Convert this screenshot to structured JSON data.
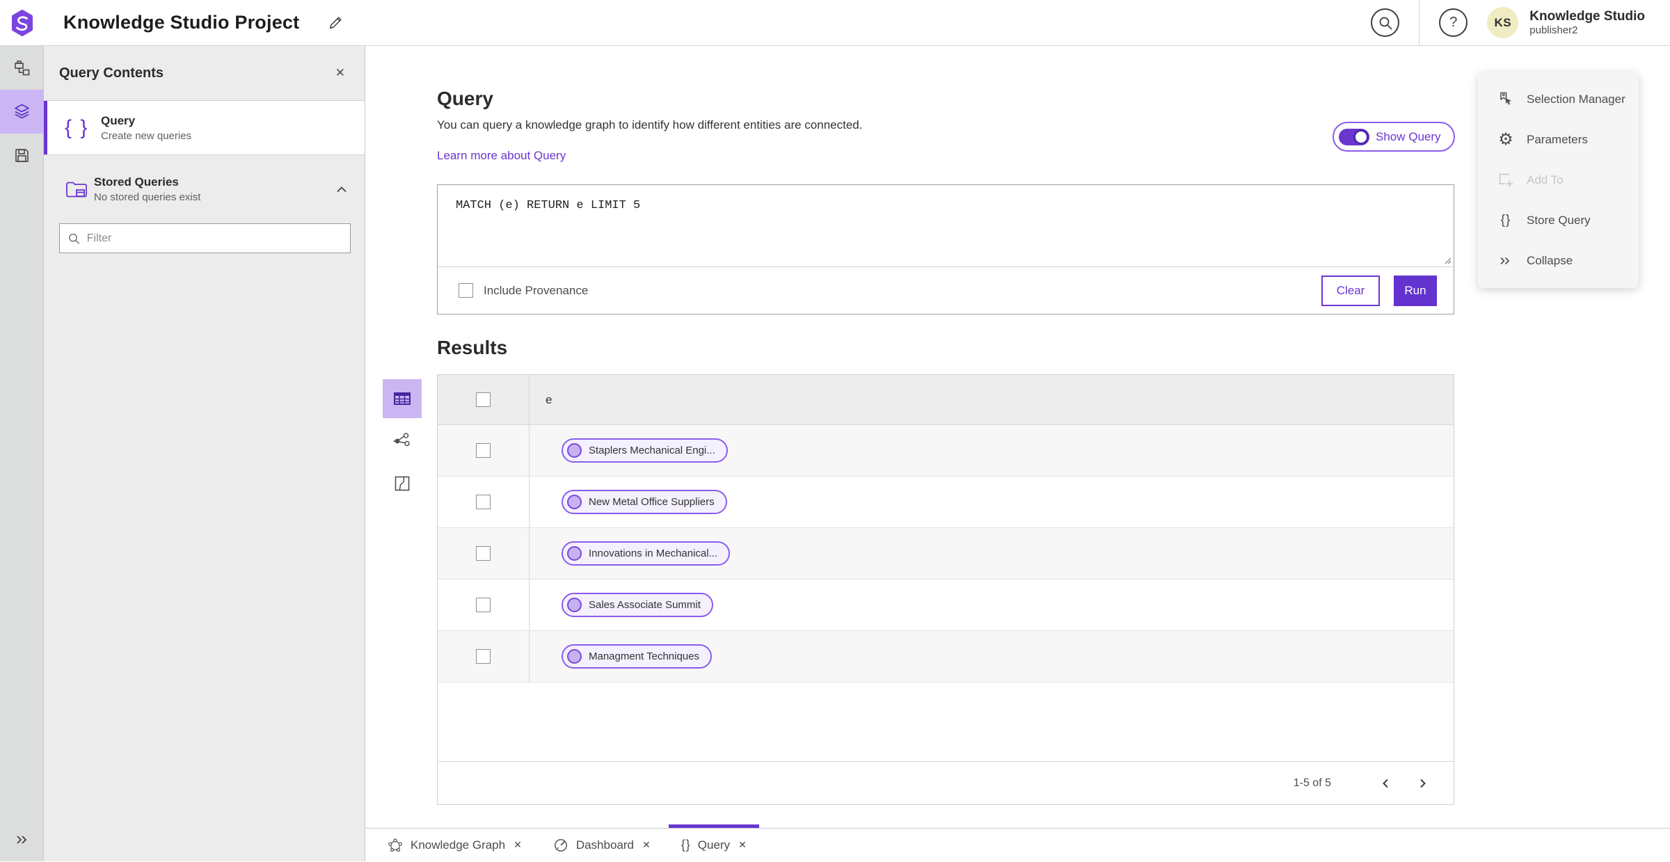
{
  "header": {
    "app_title": "Knowledge Studio Project",
    "user_name": "Knowledge Studio",
    "user_role": "publisher2",
    "avatar_initials": "KS",
    "help_glyph": "?"
  },
  "contents_panel": {
    "title": "Query Contents",
    "close_glyph": "✕",
    "query_item": {
      "label": "Query",
      "description": "Create new queries",
      "icon_glyph": "{ }"
    },
    "stored_item": {
      "label": "Stored Queries",
      "description": "No stored queries exist"
    },
    "filter_placeholder": "Filter"
  },
  "query_section": {
    "title": "Query",
    "description": "You can query a knowledge graph to identify how different entities are connected.",
    "learn_more_label": "Learn more about Query",
    "show_query_label": "Show Query",
    "query_text": "MATCH (e) RETURN e LIMIT 5",
    "include_provenance_label": "Include Provenance",
    "clear_label": "Clear",
    "run_label": "Run"
  },
  "results": {
    "title": "Results",
    "column_header": "e",
    "rows": [
      {
        "label": "Staplers Mechanical Engi..."
      },
      {
        "label": "New Metal Office Suppliers"
      },
      {
        "label": "Innovations in Mechanical..."
      },
      {
        "label": "Sales Associate Summit"
      },
      {
        "label": "Managment Techniques"
      }
    ],
    "pagination_text": "1-5 of 5"
  },
  "actions_panel": {
    "items": [
      {
        "label": "Selection Manager"
      },
      {
        "label": "Parameters"
      },
      {
        "label": "Add To"
      },
      {
        "label": "Store Query",
        "icon_glyph": "{}"
      },
      {
        "label": "Collapse"
      }
    ]
  },
  "tabs": [
    {
      "label": "Knowledge Graph",
      "close_glyph": "✕"
    },
    {
      "label": "Dashboard",
      "close_glyph": "✕"
    },
    {
      "label": "Query",
      "close_glyph": "✕",
      "icon_glyph": "{}"
    }
  ],
  "colors": {
    "accent": "#6a36d0",
    "accent_dark": "#45279e",
    "selected_tile": "#cbb6f4",
    "pill_bg": "#f4f0fd",
    "pill_border": "#8a5cee",
    "avatar_bg": "#efecc3",
    "panel_bg": "#ececec",
    "rail_bg": "#dcdddd"
  }
}
